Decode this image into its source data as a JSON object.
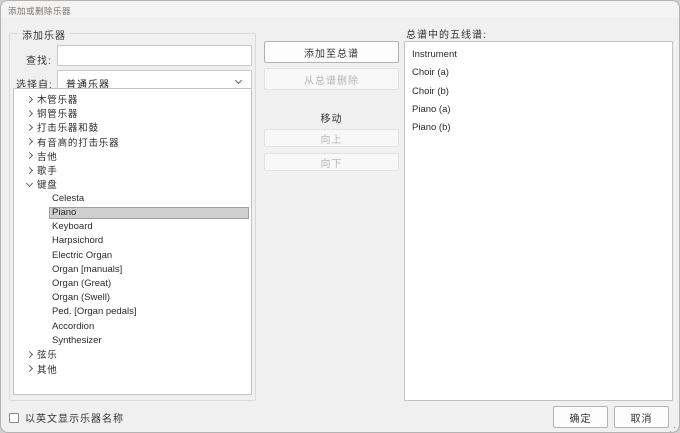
{
  "window": {
    "title": "添加或删除乐器"
  },
  "colors": {
    "selection": "#cfcfcf",
    "dialog_bg": "#f0f0f0",
    "disabled_text": "#b5b5b5"
  },
  "add_panel": {
    "group_label": "添加乐器",
    "search_label": "查找:",
    "search_value": "",
    "search_placeholder": "",
    "genre_label": "选择自:",
    "genre_value": "普通乐器",
    "tree_items": [
      {
        "label": "木管乐器",
        "type": "category"
      },
      {
        "label": "铜管乐器",
        "type": "category"
      },
      {
        "label": "打击乐器和鼓",
        "type": "category"
      },
      {
        "label": "有音高的打击乐器",
        "type": "category"
      },
      {
        "label": "吉他",
        "type": "category"
      },
      {
        "label": "歌手",
        "type": "category"
      },
      {
        "label": "键盘",
        "type": "category",
        "expanded": true
      },
      {
        "label": "Celesta",
        "type": "child"
      },
      {
        "label": "Piano",
        "type": "child",
        "selected": true
      },
      {
        "label": "Keyboard",
        "type": "child"
      },
      {
        "label": "Harpsichord",
        "type": "child"
      },
      {
        "label": "Electric Organ",
        "type": "child"
      },
      {
        "label": "Organ [manuals]",
        "type": "child"
      },
      {
        "label": "Organ (Great)",
        "type": "child"
      },
      {
        "label": "Organ (Swell)",
        "type": "child"
      },
      {
        "label": "Ped. [Organ pedals]",
        "type": "child"
      },
      {
        "label": "Accordion",
        "type": "child"
      },
      {
        "label": "Synthesizer",
        "type": "child"
      },
      {
        "label": "弦乐",
        "type": "category"
      },
      {
        "label": "其他",
        "type": "category"
      }
    ]
  },
  "middle": {
    "add_button": "添加至总谱",
    "remove_button": "从总谱删除",
    "move_label": "移动",
    "up_button": "向上",
    "down_button": "向下"
  },
  "score_panel": {
    "label": "总谱中的五线谱:",
    "staves": [
      "Instrument",
      "Choir (a)",
      "Choir (b)",
      "Piano (a)",
      "Piano (b)"
    ]
  },
  "footer": {
    "checkbox_label": "以英文显示乐器名称",
    "checkbox_checked": false,
    "ok_button": "确定",
    "cancel_button": "取消"
  }
}
